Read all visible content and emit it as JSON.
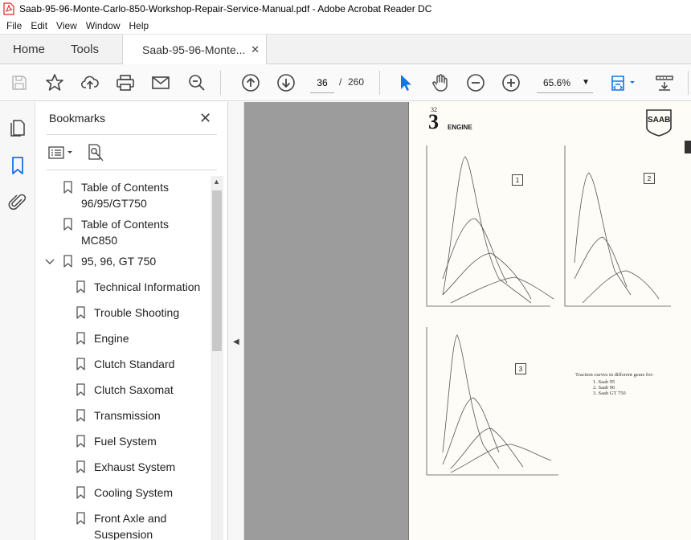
{
  "window": {
    "title": "Saab-95-96-Monte-Carlo-850-Workshop-Repair-Service-Manual.pdf - Adobe Acrobat Reader DC"
  },
  "menu": [
    "File",
    "Edit",
    "View",
    "Window",
    "Help"
  ],
  "tabs": {
    "home": "Home",
    "tools": "Tools",
    "document": "Saab-95-96-Monte...",
    "close_glyph": "✕"
  },
  "toolbar": {
    "current_page": "36",
    "page_separator": "/",
    "total_pages": "260",
    "zoom": "65.6%",
    "zoom_caret": "▼",
    "icons": [
      "save-icon",
      "bookmark-star-icon",
      "upload-icon",
      "print-icon",
      "email-icon",
      "search-zoom-icon",
      "prev-page-icon",
      "next-page-icon",
      "select-cursor-icon",
      "hand-icon",
      "zoom-out-icon",
      "zoom-in-icon",
      "fit-page-icon",
      "read-mode-icon"
    ]
  },
  "sidebar": {
    "title": "Bookmarks",
    "close_glyph": "✕",
    "bookmarks": [
      {
        "label": "Table of Contents",
        "label2": "96/95/GT750",
        "level": 0
      },
      {
        "label": "Table of Contents",
        "label2": "MC850",
        "level": 0
      },
      {
        "label": "95, 96, GT 750",
        "label2": "",
        "level": 0,
        "expanded": true
      },
      {
        "label": "Technical Information",
        "label2": "",
        "level": 1
      },
      {
        "label": "Trouble Shooting",
        "label2": "",
        "level": 1
      },
      {
        "label": "Engine",
        "label2": "",
        "level": 1
      },
      {
        "label": "Clutch Standard",
        "label2": "",
        "level": 1
      },
      {
        "label": "Clutch Saxomat",
        "label2": "",
        "level": 1
      },
      {
        "label": "Transmission",
        "label2": "",
        "level": 1
      },
      {
        "label": "Fuel System",
        "label2": "",
        "level": 1
      },
      {
        "label": "Exhaust System",
        "label2": "",
        "level": 1
      },
      {
        "label": "Cooling System",
        "label2": "",
        "level": 1
      },
      {
        "label": "Front Axle and",
        "label2": "Suspension",
        "level": 1
      }
    ]
  },
  "document_page": {
    "page_label": "32",
    "section_number": "3",
    "section_title": "ENGINE",
    "logo_text": "SAAB",
    "figure_labels": [
      "1",
      "2",
      "3"
    ],
    "legend_title": "Traction curves in different gears for:",
    "legend_items": [
      "1. Saab 95",
      "2. Saab 96",
      "3. Saab GT 750"
    ]
  },
  "colors": {
    "accent_blue": "#1473e6",
    "viewer_gray": "#9c9c9c",
    "pdf_red": "#d9251d"
  }
}
